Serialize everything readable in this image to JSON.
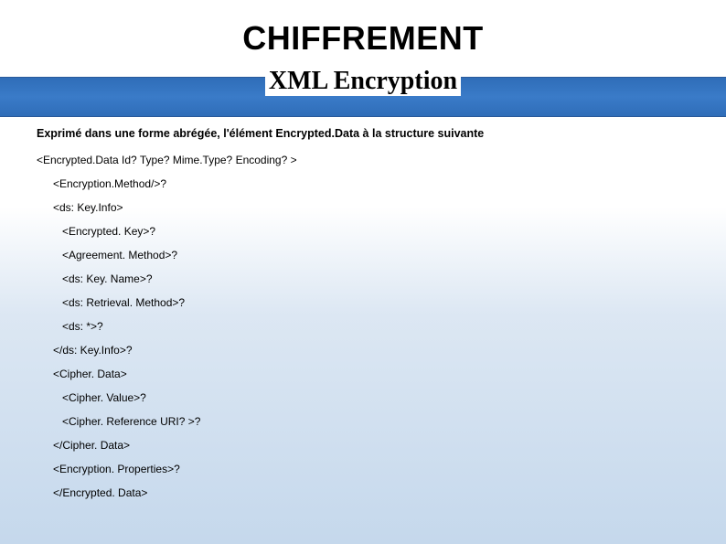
{
  "title": "CHIFFREMENT",
  "subtitle": "XML Encryption",
  "intro": "Exprimé dans une forme abrégée, l'élément Encrypted.Data à la structure suivante",
  "xml": {
    "open": "<Encrypted.Data Id? Type? Mime.Type? Encoding? >",
    "encMethod": "<Encryption.Method/>?",
    "keyInfoOpen": "<ds: Key.Info>",
    "encKey": "<Encrypted. Key>?",
    "agreeMethod": "<Agreement. Method>?",
    "keyName": "<ds: Key. Name>?",
    "retrieval": "<ds: Retrieval. Method>?",
    "dsAny": "<ds: *>?",
    "keyInfoClose": "</ds: Key.Info>?",
    "cipherDataOpen": "<Cipher. Data>",
    "cipherValue": "<Cipher. Value>?",
    "cipherRef": "<Cipher. Reference URI? >?",
    "cipherDataClose": "</Cipher. Data>",
    "encProps": "<Encryption. Properties>?",
    "close": "</Encrypted. Data>"
  }
}
